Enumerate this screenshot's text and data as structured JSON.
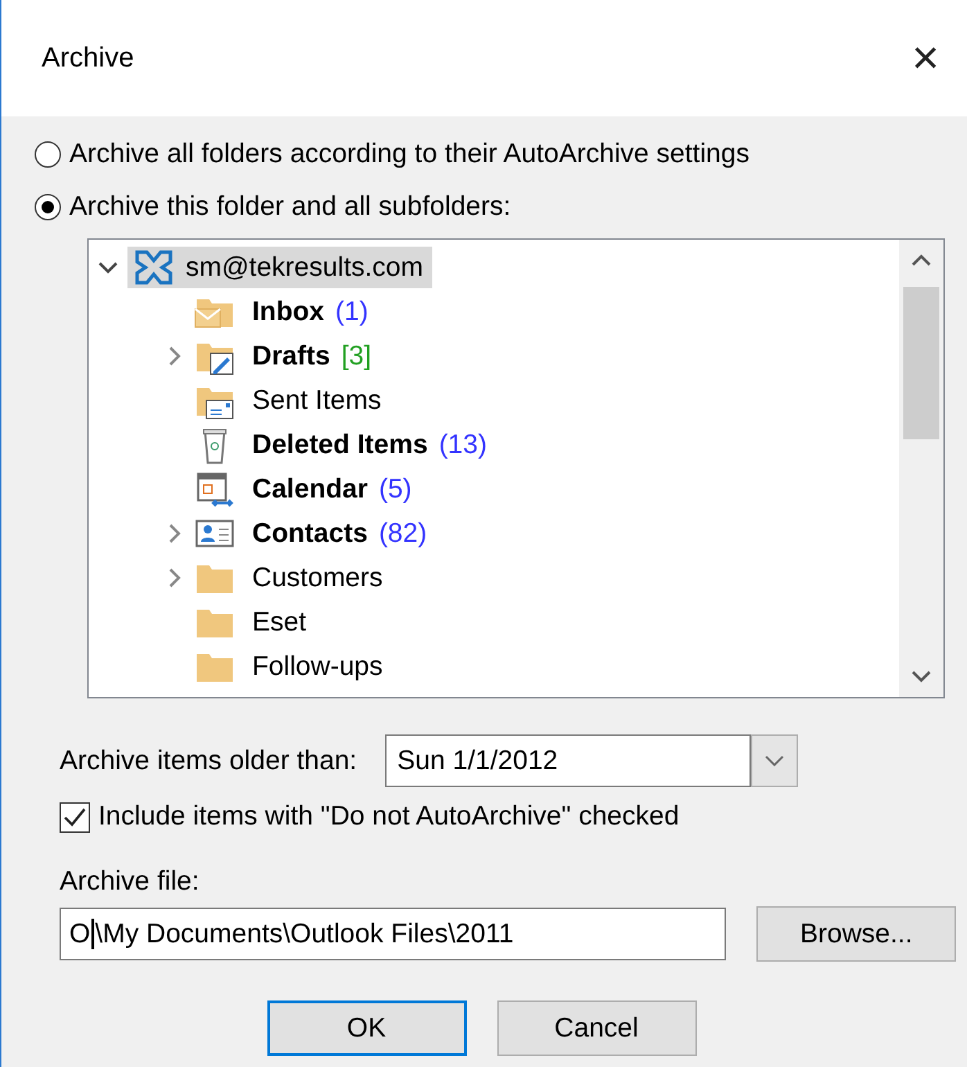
{
  "window": {
    "title": "Archive",
    "close": "×"
  },
  "scope_options": [
    {
      "label": "Archive all folders according to their AutoArchive settings",
      "selected": false
    },
    {
      "label": "Archive this folder and all subfolders:",
      "selected": true
    }
  ],
  "folder_tree": {
    "account": {
      "name": "sm@tekresults.com",
      "expanded": true,
      "selected": true
    },
    "folders": [
      {
        "name": "Inbox",
        "kind": "inbox",
        "unread": true,
        "count": "(1)",
        "color": "#3333ff",
        "has_children": false
      },
      {
        "name": "Drafts",
        "kind": "drafts",
        "unread": true,
        "count": "[3]",
        "color": "#22a022",
        "has_children": true
      },
      {
        "name": "Sent Items",
        "kind": "sent",
        "unread": false,
        "has_children": false
      },
      {
        "name": "Deleted Items",
        "kind": "deleted",
        "unread": true,
        "count": "(13)",
        "color": "#3333ff",
        "has_children": false
      },
      {
        "name": "Calendar",
        "kind": "calendar",
        "unread": true,
        "count": "(5)",
        "color": "#3333ff",
        "has_children": false
      },
      {
        "name": "Contacts",
        "kind": "contacts",
        "unread": true,
        "count": "(82)",
        "color": "#3333ff",
        "has_children": true
      },
      {
        "name": "Customers",
        "kind": "folder",
        "unread": false,
        "has_children": true
      },
      {
        "name": "Eset",
        "kind": "folder",
        "unread": false,
        "has_children": false
      },
      {
        "name": "Follow-ups",
        "kind": "folder",
        "unread": false,
        "has_children": false
      }
    ]
  },
  "older_than": {
    "label": "Archive items older than:",
    "value": "Sun 1/1/2012"
  },
  "include_option": {
    "label": "Include items with \"Do not AutoArchive\" checked",
    "checked": true
  },
  "archive_file": {
    "label": "Archive file:",
    "value": "O\\My Documents\\Outlook Files\\2011"
  },
  "buttons": [
    {
      "label": "Browse...",
      "kind": "browse"
    },
    {
      "label": "OK",
      "kind": "default"
    },
    {
      "label": "Cancel",
      "kind": "normal"
    }
  ]
}
